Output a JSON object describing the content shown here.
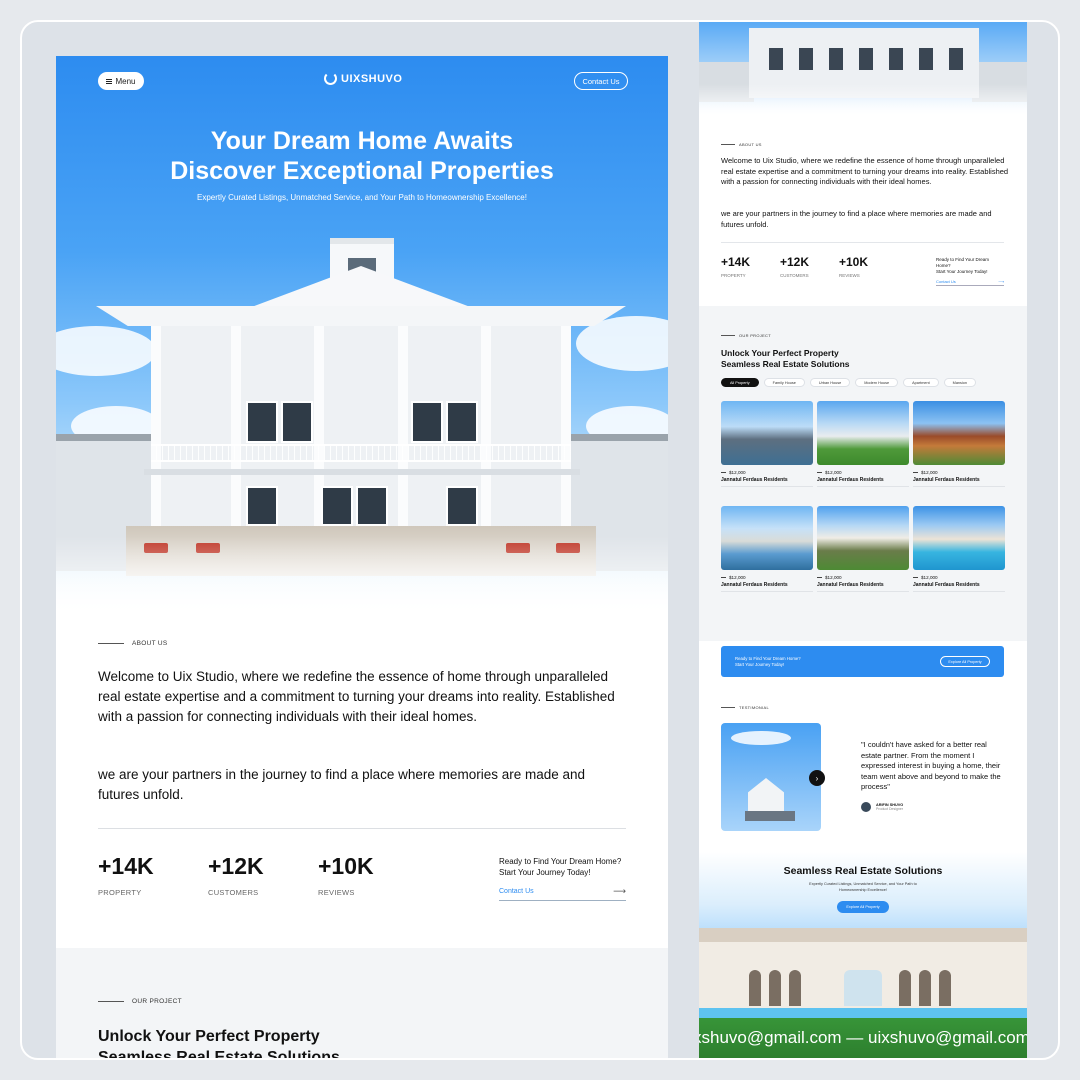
{
  "nav": {
    "menu_label": "Menu",
    "logo_text": "UIXSHUVO",
    "contact_label": "Contact Us"
  },
  "hero": {
    "title_line1": "Your Dream Home Awaits",
    "title_line2": "Discover Exceptional Properties",
    "subtitle": "Expertly Curated Listings, Unmatched Service, and Your Path to Homeownership Excellence!"
  },
  "about": {
    "label": "ABOUT US",
    "p1": "Welcome to Uix Studio, where we redefine the essence of home through unparalleled real estate expertise and a commitment to turning your dreams into reality. Established with a passion for connecting individuals with their ideal homes.",
    "p2": "we are your partners in the journey to find a place where memories are made and futures unfold."
  },
  "stats": [
    {
      "num": "+14K",
      "label": "PROPERTY"
    },
    {
      "num": "+12K",
      "label": "CUSTOMERS"
    },
    {
      "num": "+10K",
      "label": "REVIEWS"
    }
  ],
  "cta": {
    "line1": "Ready to Find Your Dream Home?",
    "line2": "Start Your Journey Today!",
    "link": "Contact Us"
  },
  "project": {
    "label": "OUR PROJECT",
    "title_line1": "Unlock Your Perfect Property",
    "title_line2": "Seamless Real Estate Solutions"
  },
  "tabs": [
    "All Property",
    "Family House",
    "Urban House",
    "Modern House",
    "Apartment",
    "Mansion"
  ],
  "cards": [
    {
      "price": "$12,000",
      "name": "Jannatul Ferdaus Residents"
    },
    {
      "price": "$12,000",
      "name": "Jannatul Ferdaus Residents"
    },
    {
      "price": "$12,000",
      "name": "Jannatul Ferdaus Residents"
    },
    {
      "price": "$12,000",
      "name": "Jannatul Ferdaus Residents"
    },
    {
      "price": "$12,000",
      "name": "Jannatul Ferdaus Residents"
    },
    {
      "price": "$12,000",
      "name": "Jannatul Ferdaus Residents"
    }
  ],
  "banner": {
    "line1": "Ready to Find Your Dream Home?",
    "line2": "Start Your Journey Today!",
    "button": "Explore All Property"
  },
  "testimonial": {
    "label": "TESTIMONIAL",
    "quote": "\"I couldn't have asked for a better real estate partner. From the moment I expressed interest in buying a home, their team went above and beyond to make the process\"",
    "author": "ARIFIN SHUVO",
    "role": "Product Designer"
  },
  "bottom": {
    "title": "Seamless Real Estate Solutions",
    "subtitle": "Expertly Curated Listings, Unmatched Service, and Your Path to Homeownership Excellence!",
    "button": "Explore All Property",
    "marquee": "xshuvo@gmail.com — uixshuvo@gmail.com"
  },
  "colors": {
    "accent": "#2d8cf0",
    "text": "#111111",
    "background": "#dde2e8"
  }
}
